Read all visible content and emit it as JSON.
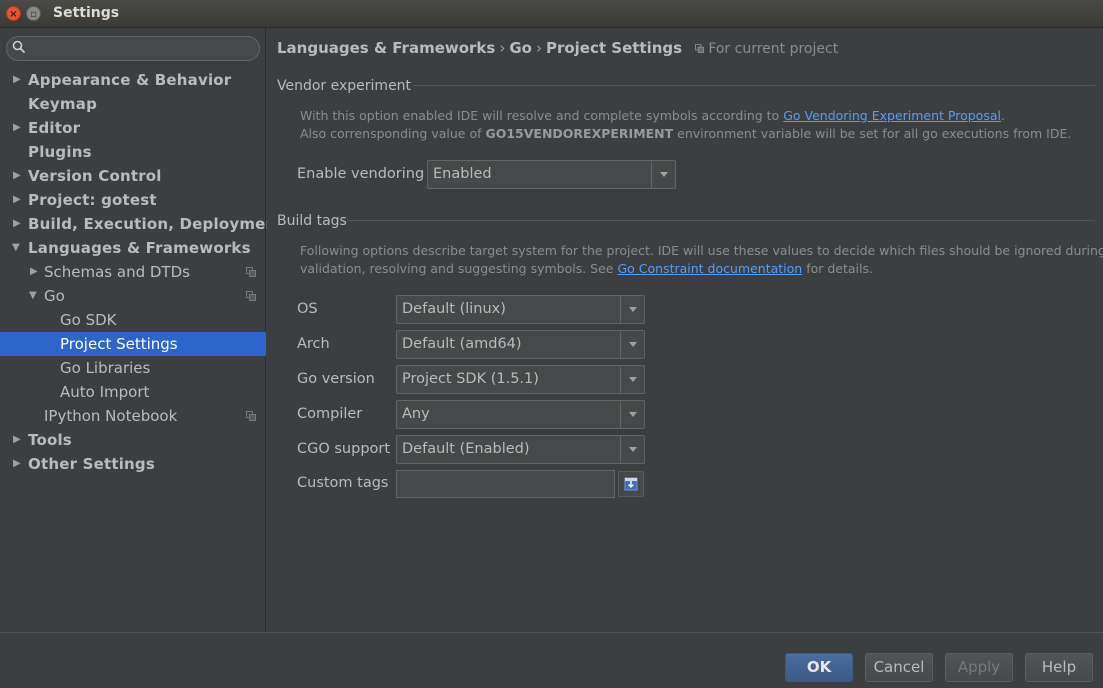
{
  "window": {
    "title": "Settings",
    "close_glyph": "×",
    "max_glyph": "▫"
  },
  "sidebar": {
    "search_placeholder": "",
    "items": [
      {
        "label": "Appearance & Behavior",
        "arrow": "▶"
      },
      {
        "label": "Keymap",
        "arrow": ""
      },
      {
        "label": "Editor",
        "arrow": "▶"
      },
      {
        "label": "Plugins",
        "arrow": ""
      },
      {
        "label": "Version Control",
        "arrow": "▶"
      },
      {
        "label": "Project: gotest",
        "arrow": "▶"
      },
      {
        "label": "Build, Execution, Deployment",
        "arrow": "▶"
      },
      {
        "label": "Languages & Frameworks",
        "arrow": "▼"
      },
      {
        "label": "Schemas and DTDs",
        "arrow": "▶"
      },
      {
        "label": "Go",
        "arrow": "▼"
      },
      {
        "label": "Go SDK",
        "arrow": ""
      },
      {
        "label": "Project Settings",
        "arrow": ""
      },
      {
        "label": "Go Libraries",
        "arrow": ""
      },
      {
        "label": "Auto Import",
        "arrow": ""
      },
      {
        "label": "IPython Notebook",
        "arrow": ""
      },
      {
        "label": "Tools",
        "arrow": "▶"
      },
      {
        "label": "Other Settings",
        "arrow": "▶"
      }
    ],
    "selected": "Project Settings"
  },
  "breadcrumb": {
    "parts": [
      "Languages & Frameworks",
      "Go",
      "Project Settings"
    ],
    "separator": "›",
    "scope": "For current project"
  },
  "vendor": {
    "title": "Vendor experiment",
    "desc_line1_pre": "With this option enabled IDE will resolve and complete symbols according to ",
    "desc_link": "Go Vendoring Experiment Proposal",
    "desc_line1_post": ".",
    "desc_line2_pre": "Also corrensponding value of ",
    "desc_env": "GO15VENDOREXPERIMENT",
    "desc_line2_post": " environment variable will be set for all go executions from IDE.",
    "enable_label": "Enable vendoring",
    "enable_value": "Enabled"
  },
  "build_tags": {
    "title": "Build tags",
    "desc_line1": "Following options describe target system for the project. IDE will use these values to decide which files should be ignored during",
    "desc_line2_pre": "validation, resolving and suggesting symbols. See ",
    "desc_link": "Go Constraint documentation",
    "desc_line2_post": " for details.",
    "fields": {
      "os": {
        "label": "OS",
        "value": "Default (linux)"
      },
      "arch": {
        "label": "Arch",
        "value": "Default (amd64)"
      },
      "go_version": {
        "label": "Go version",
        "value": "Project SDK (1.5.1)"
      },
      "compiler": {
        "label": "Compiler",
        "value": "Any"
      },
      "cgo": {
        "label": "CGO support",
        "value": "Default (Enabled)"
      },
      "custom": {
        "label": "Custom tags",
        "value": ""
      }
    }
  },
  "buttons": {
    "ok": "OK",
    "cancel": "Cancel",
    "apply": "Apply",
    "help": "Help"
  },
  "colors": {
    "selection": "#2f65ca",
    "link": "#589df6",
    "primary_button": "#3c5a85"
  }
}
